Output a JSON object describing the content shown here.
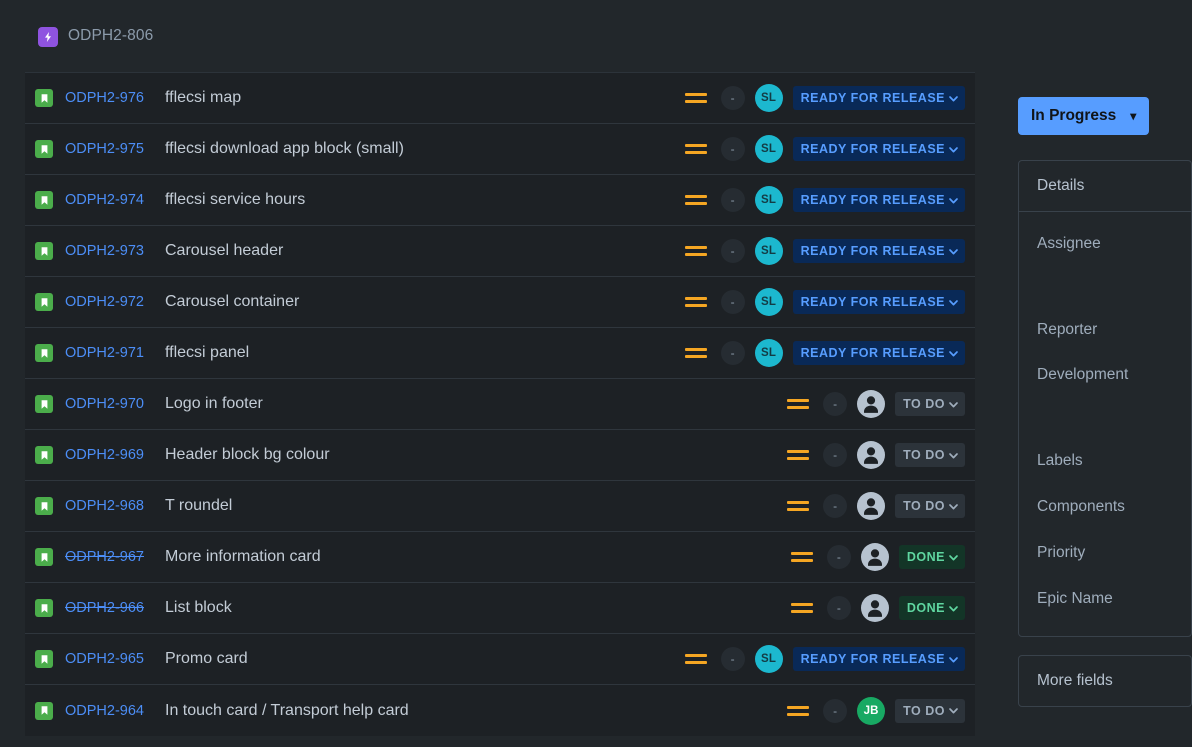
{
  "epic": {
    "key": "ODPH2-806",
    "icon": "epic-lightning-icon"
  },
  "issue_list": {
    "columns": [
      "type",
      "key",
      "summary",
      "priority",
      "estimate",
      "assignee",
      "status"
    ],
    "rows": [
      {
        "type_icon": "story-icon",
        "key": "ODPH2-976",
        "key_struck": false,
        "summary": "fflecsi map",
        "priority": "Medium",
        "estimate": "-",
        "assignee_initials": "SL",
        "assignee_kind": "teal",
        "status": "READY FOR RELEASE",
        "status_kind": "inprogress-blue"
      },
      {
        "type_icon": "story-icon",
        "key": "ODPH2-975",
        "key_struck": false,
        "summary": "fflecsi download app block (small)",
        "priority": "Medium",
        "estimate": "-",
        "assignee_initials": "SL",
        "assignee_kind": "teal",
        "status": "READY FOR RELEASE",
        "status_kind": "inprogress-blue"
      },
      {
        "type_icon": "story-icon",
        "key": "ODPH2-974",
        "key_struck": false,
        "summary": "fflecsi service hours",
        "priority": "Medium",
        "estimate": "-",
        "assignee_initials": "SL",
        "assignee_kind": "teal",
        "status": "READY FOR RELEASE",
        "status_kind": "inprogress-blue"
      },
      {
        "type_icon": "story-icon",
        "key": "ODPH2-973",
        "key_struck": false,
        "summary": "Carousel header",
        "priority": "Medium",
        "estimate": "-",
        "assignee_initials": "SL",
        "assignee_kind": "teal",
        "status": "READY FOR RELEASE",
        "status_kind": "inprogress-blue"
      },
      {
        "type_icon": "story-icon",
        "key": "ODPH2-972",
        "key_struck": false,
        "summary": "Carousel container",
        "priority": "Medium",
        "estimate": "-",
        "assignee_initials": "SL",
        "assignee_kind": "teal",
        "status": "READY FOR RELEASE",
        "status_kind": "inprogress-blue"
      },
      {
        "type_icon": "story-icon",
        "key": "ODPH2-971",
        "key_struck": false,
        "summary": "fflecsi panel",
        "priority": "Medium",
        "estimate": "-",
        "assignee_initials": "SL",
        "assignee_kind": "teal",
        "status": "READY FOR RELEASE",
        "status_kind": "inprogress-blue"
      },
      {
        "type_icon": "story-icon",
        "key": "ODPH2-970",
        "key_struck": false,
        "summary": "Logo in footer",
        "priority": "Medium",
        "estimate": "-",
        "assignee_initials": "",
        "assignee_kind": "anon",
        "status": "TO DO",
        "status_kind": "todo"
      },
      {
        "type_icon": "story-icon",
        "key": "ODPH2-969",
        "key_struck": false,
        "summary": "Header block bg colour",
        "priority": "Medium",
        "estimate": "-",
        "assignee_initials": "",
        "assignee_kind": "anon",
        "status": "TO DO",
        "status_kind": "todo"
      },
      {
        "type_icon": "story-icon",
        "key": "ODPH2-968",
        "key_struck": false,
        "summary": "T roundel",
        "priority": "Medium",
        "estimate": "-",
        "assignee_initials": "",
        "assignee_kind": "anon",
        "status": "TO DO",
        "status_kind": "todo"
      },
      {
        "type_icon": "story-icon",
        "key": "ODPH2-967",
        "key_struck": true,
        "summary": "More information card",
        "priority": "Medium",
        "estimate": "-",
        "assignee_initials": "",
        "assignee_kind": "anon",
        "status": "DONE",
        "status_kind": "done"
      },
      {
        "type_icon": "story-icon",
        "key": "ODPH2-966",
        "key_struck": true,
        "summary": "List block",
        "priority": "Medium",
        "estimate": "-",
        "assignee_initials": "",
        "assignee_kind": "anon",
        "status": "DONE",
        "status_kind": "done"
      },
      {
        "type_icon": "story-icon",
        "key": "ODPH2-965",
        "key_struck": false,
        "summary": "Promo card",
        "priority": "Medium",
        "estimate": "-",
        "assignee_initials": "SL",
        "assignee_kind": "teal",
        "status": "READY FOR RELEASE",
        "status_kind": "inprogress-blue"
      },
      {
        "type_icon": "story-icon",
        "key": "ODPH2-964",
        "key_struck": false,
        "summary": "In touch card / Transport help card",
        "priority": "Medium",
        "estimate": "-",
        "assignee_initials": "JB",
        "assignee_kind": "green",
        "status": "TO DO",
        "status_kind": "todo"
      }
    ]
  },
  "right_panel": {
    "status_button": {
      "label": "In Progress",
      "caret": "chevron-down-icon"
    },
    "details": {
      "header": "Details",
      "fields": [
        {
          "label": "Assignee",
          "tall": true
        },
        {
          "label": "Reporter",
          "tall": false
        },
        {
          "label": "Development",
          "tall": true
        },
        {
          "label": "Labels",
          "tall": false
        },
        {
          "label": "Components",
          "tall": false
        },
        {
          "label": "Priority",
          "tall": false
        },
        {
          "label": "Epic Name",
          "tall": false
        }
      ]
    },
    "more_fields": {
      "header": "More fields"
    }
  },
  "colors": {
    "page_bg": "#22272b",
    "list_bg": "#1d2125",
    "link_blue": "#4c8ef7",
    "accent_blue": "#579dff",
    "story_green": "#4bad4b",
    "epic_purple": "#8f53e0",
    "priority_amber": "#f5a623",
    "avatar_teal": "#1cb8cf",
    "avatar_green": "#18a963",
    "done_green": "#5fd6a0"
  }
}
